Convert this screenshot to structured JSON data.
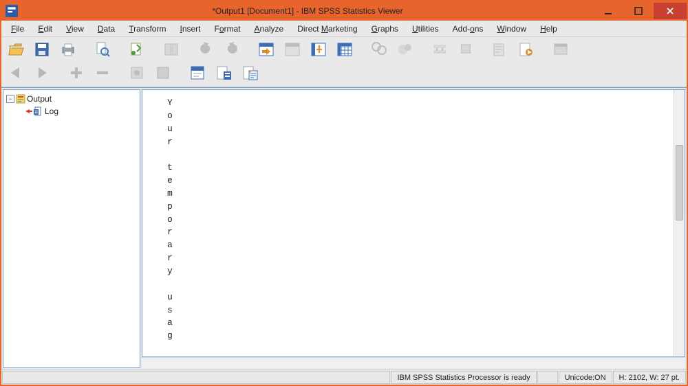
{
  "window": {
    "title": "*Output1 [Document1] - IBM SPSS Statistics Viewer"
  },
  "menu": {
    "file": {
      "label": "File",
      "accel_index": 0
    },
    "edit": {
      "label": "Edit",
      "accel_index": 0
    },
    "view": {
      "label": "View",
      "accel_index": 0
    },
    "data": {
      "label": "Data",
      "accel_index": 0
    },
    "transform": {
      "label": "Transform",
      "accel_index": 0
    },
    "insert": {
      "label": "Insert",
      "accel_index": 0
    },
    "format": {
      "label": "Format",
      "accel_index": 1
    },
    "analyze": {
      "label": "Analyze",
      "accel_index": 0
    },
    "direct": {
      "label": "Direct Marketing",
      "accel_index": 7
    },
    "graphs": {
      "label": "Graphs",
      "accel_index": 0
    },
    "utilities": {
      "label": "Utilities",
      "accel_index": 0
    },
    "addons": {
      "label": "Add-ons",
      "accel_index": 4
    },
    "window": {
      "label": "Window",
      "accel_index": 0
    },
    "help": {
      "label": "Help",
      "accel_index": 0
    }
  },
  "tree": {
    "root_label": "Output",
    "child_label": "Log"
  },
  "output": {
    "chars": [
      "Y",
      "o",
      "u",
      "r",
      "",
      "t",
      "e",
      "m",
      "p",
      "o",
      "r",
      "a",
      "r",
      "y",
      "",
      "u",
      "s",
      "a",
      "g"
    ]
  },
  "status": {
    "processor": "IBM SPSS Statistics Processor is ready",
    "unicode": "Unicode:ON",
    "dims": "H: 2102, W: 27 pt."
  }
}
